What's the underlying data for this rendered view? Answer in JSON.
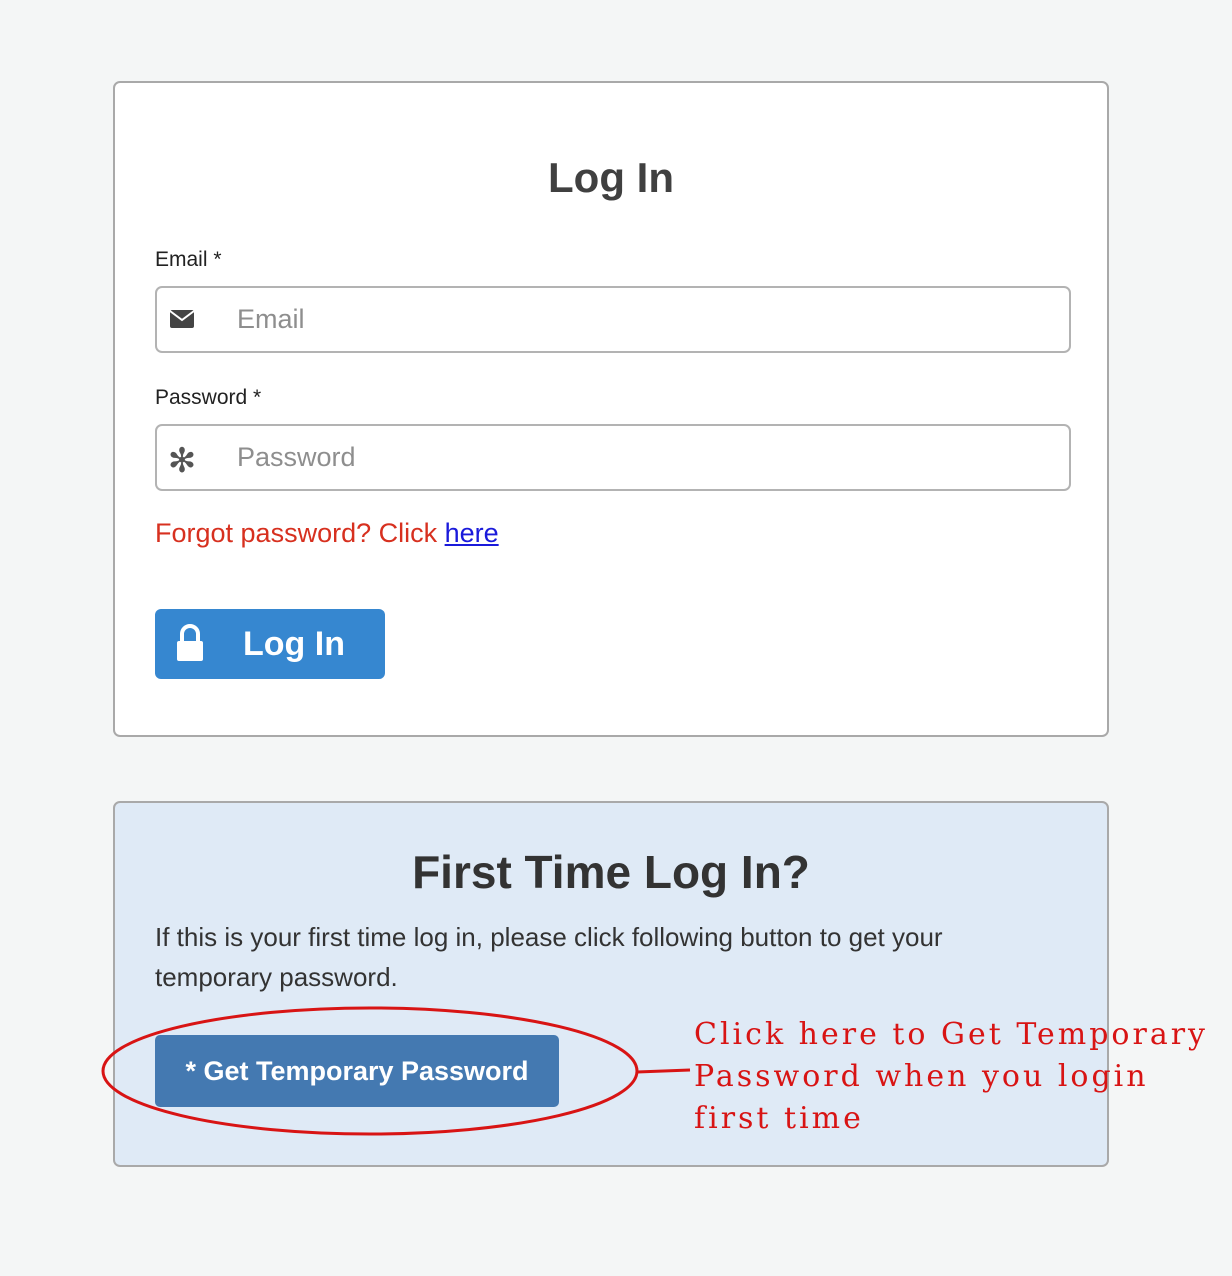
{
  "login": {
    "title": "Log In",
    "email_label": "Email *",
    "email_placeholder": "Email",
    "email_value": "",
    "password_label": "Password *",
    "password_placeholder": "Password",
    "password_value": "",
    "forgot_text": "Forgot password? Click ",
    "forgot_link": "here",
    "button_label": "Log In",
    "button_icon": "lock-icon",
    "button_color": "#3687d0"
  },
  "first_time": {
    "title": "First Time Log In?",
    "description": "If this is your first time log in, please click following button to get your temporary password.",
    "button_label": "* Get Temporary Password",
    "button_color": "#4479b1",
    "panel_color": "#dfeaf6"
  },
  "annotation": {
    "text": "Click here to Get Temporary\nPassword when you login\nfirst time",
    "color": "#d81414"
  },
  "icons": {
    "email": "envelope-icon",
    "password": "asterisk-icon",
    "asterisk_glyph": "✻"
  }
}
